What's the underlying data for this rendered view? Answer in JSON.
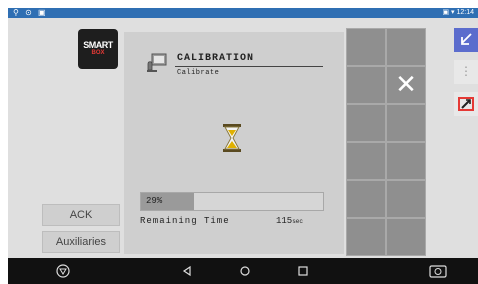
{
  "status_bar": {
    "left_icons": [
      "settings-icon",
      "location-icon",
      "usb-icon"
    ],
    "time": "12:14",
    "right_icons": [
      "cast-icon",
      "wifi-icon"
    ]
  },
  "app": {
    "logo": {
      "line1": "SMART",
      "line2": "BOX"
    },
    "buttons": {
      "ack": "ACK",
      "auxiliaries": "Auxiliaries"
    }
  },
  "calibration": {
    "title": "CALIBRATION",
    "subtitle": "Calibrate",
    "progress_percent": 29,
    "progress_text": "29%",
    "remaining_label": "Remaining Time",
    "remaining_value": "115",
    "remaining_unit": "sec"
  },
  "softkeys": {
    "rows": 6,
    "cols": 2,
    "close_symbol": "✕"
  },
  "right_controls": {
    "more_symbol": "⋮"
  },
  "colors": {
    "status_bar": "#2f6fb3",
    "app_background": "#dfdfdf",
    "panel": "#cfcfcf",
    "softkey": "#8f8f8f",
    "accent": "#5b6ccd",
    "hourglass": "#e0b100",
    "nav_bar": "#111111"
  }
}
